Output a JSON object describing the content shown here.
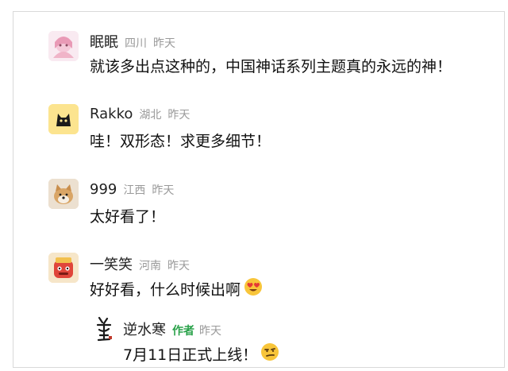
{
  "comments": [
    {
      "name": "眠眠",
      "location": "四川",
      "time": "昨天",
      "text": "就该多出点这种的，中国神话系列主题真的永远的神！",
      "avatar_icon": "anime-girl-avatar"
    },
    {
      "name": "Rakko",
      "location": "湖北",
      "time": "昨天",
      "text": "哇！双形态！求更多细节！",
      "avatar_icon": "black-cat-avatar"
    },
    {
      "name": "999",
      "location": "江西",
      "time": "昨天",
      "text": "太好看了！",
      "avatar_icon": "shiba-dog-avatar"
    },
    {
      "name": "一笑笑",
      "location": "河南",
      "time": "昨天",
      "text": "好好看，什么时候出啊",
      "emoji": "heart-eyes-emoji",
      "avatar_icon": "red-cartoon-avatar"
    }
  ],
  "reply": {
    "name": "逆水寒",
    "tag": "作者",
    "time": "昨天",
    "text": "7月11日正式上线！",
    "emoji": "smirk-emoji",
    "avatar_icon": "calligraphy-logo-avatar"
  },
  "colors": {
    "author_tag": "#2aa24a",
    "meta_gray": "#9a9a9a",
    "text": "#111111"
  }
}
